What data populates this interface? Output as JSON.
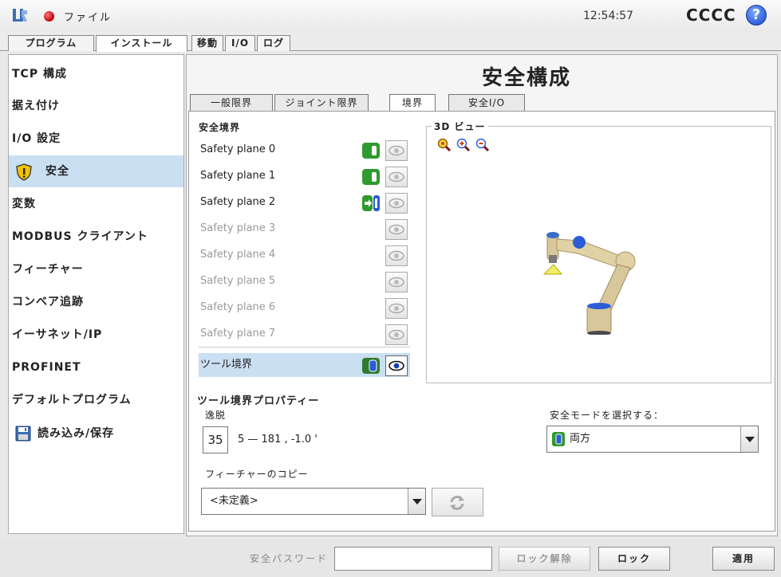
{
  "header": {
    "menu_label": "ファイル",
    "time": "12:54:57",
    "robot_name": "CCCC",
    "help_symbol": "?"
  },
  "top_tabs": [
    {
      "label": "プログラム",
      "active": false
    },
    {
      "label": "インストール",
      "active": true
    },
    {
      "label": "移動",
      "active": false
    },
    {
      "label": "I/O",
      "active": false
    },
    {
      "label": "ログ",
      "active": false
    }
  ],
  "sidebar": {
    "items": [
      {
        "label": "TCP 構成"
      },
      {
        "label": "据え付け"
      },
      {
        "label": "I/O 設定"
      },
      {
        "label": "安全",
        "icon": "warning-shield-icon",
        "active": true
      },
      {
        "label": "変数"
      },
      {
        "label": "MODBUS クライアント"
      },
      {
        "label": "フィーチャー"
      },
      {
        "label": "コンベア追跡"
      },
      {
        "label": "イーサネット/IP"
      },
      {
        "label": "PROFINET"
      },
      {
        "label": "デフォルトプログラム"
      },
      {
        "label": "読み込み/保存",
        "icon": "floppy-disk-icon"
      }
    ]
  },
  "main": {
    "title": "安全構成",
    "subtabs": [
      {
        "label": "一般限界",
        "active": false
      },
      {
        "label": "ジョイント限界",
        "active": false
      },
      {
        "label": "境界",
        "active": true
      },
      {
        "label": "安全I/O",
        "active": false
      }
    ],
    "boundaries": {
      "heading": "安全境界",
      "planes": [
        {
          "label": "Safety plane 0",
          "enabled": true,
          "mode_icon": "toggle-green-icon",
          "visible": false
        },
        {
          "label": "Safety plane 1",
          "enabled": true,
          "mode_icon": "toggle-green-icon",
          "visible": false
        },
        {
          "label": "Safety plane 2",
          "enabled": true,
          "mode_icon": "trigger-reduced-icon",
          "visible": false
        },
        {
          "label": "Safety plane 3",
          "enabled": false,
          "visible": false
        },
        {
          "label": "Safety plane 4",
          "enabled": false,
          "visible": false
        },
        {
          "label": "Safety plane 5",
          "enabled": false,
          "visible": false
        },
        {
          "label": "Safety plane 6",
          "enabled": false,
          "visible": false
        },
        {
          "label": "Safety plane 7",
          "enabled": false,
          "visible": false
        }
      ],
      "tool_boundary": {
        "label": "ツール境界",
        "mode_icon": "toggle-blue-icon",
        "visible": true,
        "selected": true
      }
    },
    "view3d": {
      "label": "3D ビュー",
      "zoom_icons": [
        "zoom-fit-icon",
        "zoom-in-icon",
        "zoom-out-icon"
      ]
    },
    "tool_props": {
      "heading": "ツール境界プロパティー",
      "deviation_label": "逸脱",
      "deviation_value": "35",
      "range_text": "5 — 181 , -1.0 '",
      "feature_copy_label": "フィーチャーのコピー",
      "feature_value": "<未定義>"
    },
    "safety_mode": {
      "label": "安全モードを選択する：",
      "value": "両方"
    }
  },
  "footer": {
    "password_label": "安全パスワード",
    "password_value": "",
    "unlock_label": "ロック解除",
    "lock_label": "ロック",
    "apply_label": "適用"
  },
  "colors": {
    "toggle_green": "#2f9a2f",
    "toggle_blue": "#2f7a2f",
    "selection": "#c9dff2",
    "disabled_text": "#9a9a9a"
  }
}
